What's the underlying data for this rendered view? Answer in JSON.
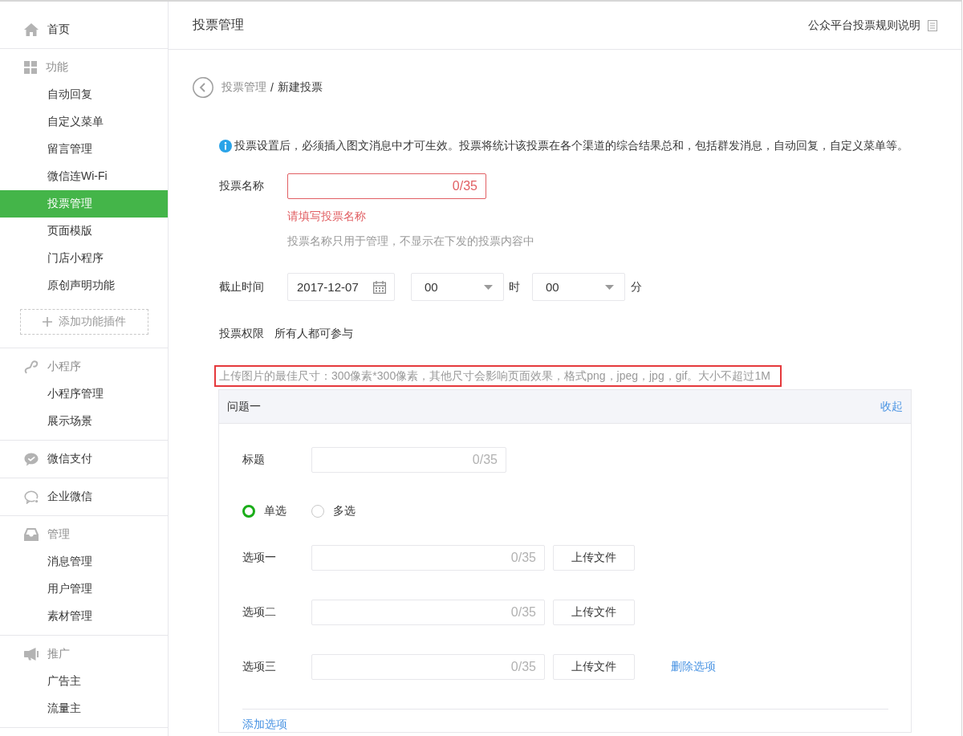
{
  "sidebar": {
    "sections": [
      {
        "kind": "link",
        "label": "首页"
      },
      {
        "kind": "group",
        "label": "功能",
        "items": [
          {
            "label": "自动回复",
            "selected": false
          },
          {
            "label": "自定义菜单",
            "selected": false
          },
          {
            "label": "留言管理",
            "selected": false
          },
          {
            "label": "微信连Wi-Fi",
            "selected": false
          },
          {
            "label": "投票管理",
            "selected": true
          },
          {
            "label": "页面模版",
            "selected": false
          },
          {
            "label": "门店小程序",
            "selected": false
          },
          {
            "label": "原创声明功能",
            "selected": false
          }
        ],
        "add_button": "添加功能插件"
      },
      {
        "kind": "group",
        "label": "小程序",
        "items": [
          {
            "label": "小程序管理",
            "selected": false
          },
          {
            "label": "展示场景",
            "selected": false
          }
        ]
      },
      {
        "kind": "link",
        "label": "微信支付"
      },
      {
        "kind": "link",
        "label": "企业微信"
      },
      {
        "kind": "group",
        "label": "管理",
        "items": [
          {
            "label": "消息管理",
            "selected": false
          },
          {
            "label": "用户管理",
            "selected": false
          },
          {
            "label": "素材管理",
            "selected": false
          }
        ]
      },
      {
        "kind": "group",
        "label": "推广",
        "items": [
          {
            "label": "广告主",
            "selected": false
          },
          {
            "label": "流量主",
            "selected": false
          }
        ]
      }
    ]
  },
  "header": {
    "title": "投票管理",
    "help_link": "公众平台投票规则说明"
  },
  "breadcrumb": {
    "parent": "投票管理",
    "separator": "/",
    "current": "新建投票"
  },
  "notice": "投票设置后，必须插入图文消息中才可生效。投票将统计该投票在各个渠道的综合结果总和，包括群发消息，自动回复，自定义菜单等。",
  "form": {
    "name": {
      "label": "投票名称",
      "counter": "0/35",
      "invalid": true,
      "error": "请填写投票名称",
      "hint": "投票名称只用于管理，不显示在下发的投票内容中"
    },
    "deadline": {
      "label": "截止时间",
      "date": "2017-12-07",
      "hour": "00",
      "hour_unit": "时",
      "minute": "00",
      "minute_unit": "分"
    },
    "permission": {
      "label": "投票权限",
      "value": "所有人都可参与"
    },
    "upload_note": {
      "text": "上传图片的最佳尺寸：300像素*300像素，其他尺寸会影响页面效果，格式png，jpeg，jpg，gif。大小不超过1M",
      "highlighted": true
    }
  },
  "questions": [
    {
      "title": "问题一",
      "collapse_link": "收起",
      "title_field": {
        "label": "标题",
        "counter": "0/35"
      },
      "modes": [
        {
          "label": "单选",
          "selected": true
        },
        {
          "label": "多选",
          "selected": false
        }
      ],
      "options": [
        {
          "label": "选项一",
          "counter": "0/35",
          "upload_button": "上传文件"
        },
        {
          "label": "选项二",
          "counter": "0/35",
          "upload_button": "上传文件"
        },
        {
          "label": "选项三",
          "counter": "0/35",
          "upload_button": "上传文件",
          "delete_link": "删除选项"
        }
      ],
      "add_option": "添加选项"
    }
  ]
}
